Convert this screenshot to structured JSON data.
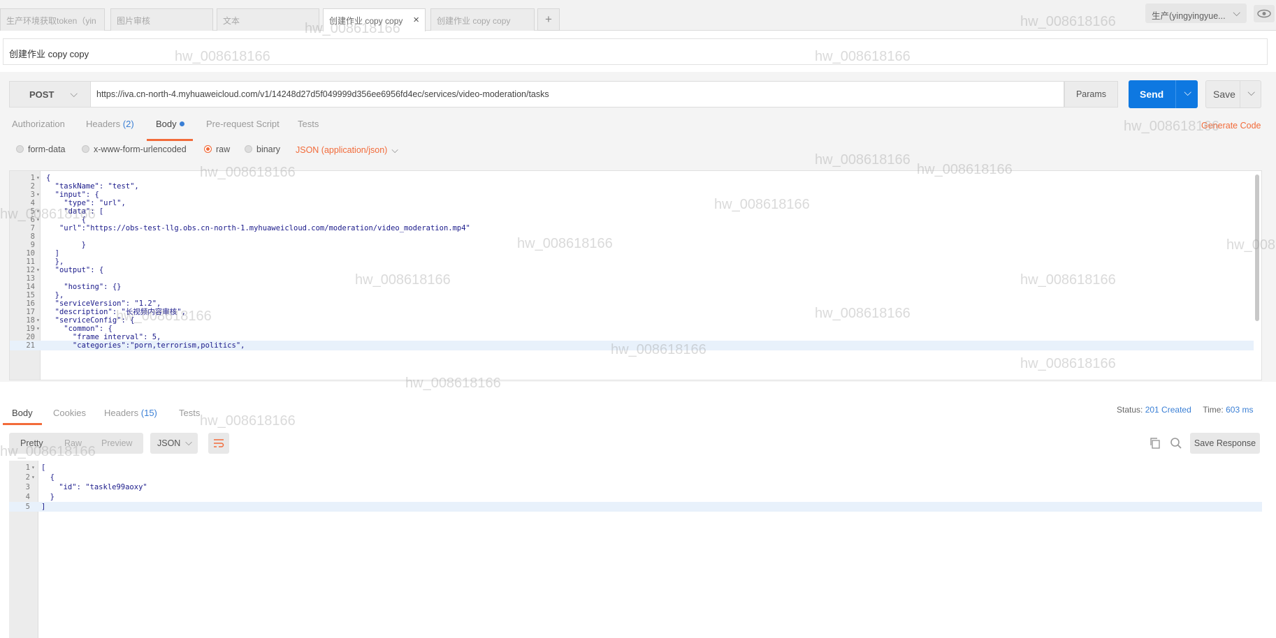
{
  "tabs": [
    {
      "label": "生产环境获取token（yin",
      "active": false
    },
    {
      "label": "图片审核",
      "active": false
    },
    {
      "label": "文本",
      "active": false
    },
    {
      "label": "创建作业 copy copy",
      "active": true
    },
    {
      "label": "创建作业 copy copy",
      "active": false
    }
  ],
  "tab_add_label": "+",
  "environment": "生产(yingyingyue...",
  "request_name": "创建作业 copy copy",
  "request": {
    "method": "POST",
    "url": "https://iva.cn-north-4.myhuaweicloud.com/v1/14248d27d5f049999d356ee6956fd4ec/services/video-moderation/tasks",
    "params_label": "Params",
    "send_label": "Send",
    "save_label": "Save"
  },
  "request_tabs": {
    "authorization": "Authorization",
    "headers": "Headers",
    "headers_count": "(2)",
    "body": "Body",
    "prerequest": "Pre-request Script",
    "tests": "Tests"
  },
  "generate_code": "Generate Code",
  "body_types": {
    "form_data": "form-data",
    "urlencoded": "x-www-form-urlencoded",
    "raw": "raw",
    "binary": "binary",
    "content_type": "JSON (application/json)",
    "selected": "raw"
  },
  "request_body_lines": [
    {
      "n": "1",
      "fold": true,
      "text": "{"
    },
    {
      "n": "2",
      "fold": false,
      "text": "  \"taskName\": \"test\","
    },
    {
      "n": "3",
      "fold": true,
      "text": "  \"input\": {"
    },
    {
      "n": "4",
      "fold": false,
      "text": "    \"type\": \"url\","
    },
    {
      "n": "5",
      "fold": true,
      "text": "    \"data\": ["
    },
    {
      "n": "6",
      "fold": true,
      "text": "        {"
    },
    {
      "n": "7",
      "fold": false,
      "text": "   \"url\":\"https://obs-test-llg.obs.cn-north-1.myhuaweicloud.com/moderation/video_moderation.mp4\""
    },
    {
      "n": "8",
      "fold": false,
      "text": ""
    },
    {
      "n": "9",
      "fold": false,
      "text": "        }"
    },
    {
      "n": "10",
      "fold": false,
      "text": "  ]"
    },
    {
      "n": "11",
      "fold": false,
      "text": "  },"
    },
    {
      "n": "12",
      "fold": true,
      "text": "  \"output\": {"
    },
    {
      "n": "13",
      "fold": false,
      "text": ""
    },
    {
      "n": "14",
      "fold": false,
      "text": "    \"hosting\": {}"
    },
    {
      "n": "15",
      "fold": false,
      "text": "  },"
    },
    {
      "n": "16",
      "fold": false,
      "text": "  \"serviceVersion\": \"1.2\","
    },
    {
      "n": "17",
      "fold": false,
      "text": "  \"description\": \"长视频内容审核\","
    },
    {
      "n": "18",
      "fold": true,
      "text": "  \"serviceConfig\": {"
    },
    {
      "n": "19",
      "fold": true,
      "text": "    \"common\": {"
    },
    {
      "n": "20",
      "fold": false,
      "text": "      \"frame_interval\": 5,"
    },
    {
      "n": "21",
      "fold": false,
      "text": "      \"categories\":\"porn,terrorism,politics\","
    }
  ],
  "highlighted_request_line": "21",
  "response_tabs": {
    "body": "Body",
    "cookies": "Cookies",
    "headers": "Headers",
    "headers_count": "(15)",
    "tests": "Tests"
  },
  "response_status": {
    "status_label": "Status:",
    "status_value": "201 Created",
    "time_label": "Time:",
    "time_value": "603 ms"
  },
  "response_view": {
    "pretty": "Pretty",
    "raw": "Raw",
    "preview": "Preview",
    "format": "JSON",
    "save_response": "Save Response"
  },
  "response_body_lines": [
    {
      "n": "1",
      "fold": true,
      "text": "["
    },
    {
      "n": "2",
      "fold": true,
      "text": "  {"
    },
    {
      "n": "3",
      "fold": false,
      "text": "    \"id\": \"taskle99aoxy\""
    },
    {
      "n": "4",
      "fold": false,
      "text": "  }"
    },
    {
      "n": "5",
      "fold": false,
      "text": "]"
    }
  ],
  "highlighted_response_line": "5",
  "watermark_text": "hw_008618166",
  "colors": {
    "accent": "#f26b3a",
    "send": "#0e78e1",
    "link": "#3a7fd5"
  }
}
